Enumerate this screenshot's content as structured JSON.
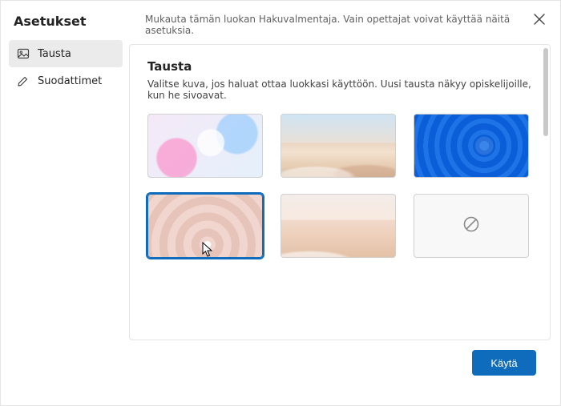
{
  "dialog": {
    "title": "Asetukset",
    "intro": "Mukauta tämän luokan Hakuvalmentaja. Vain opettajat voivat käyttää näitä asetuksia."
  },
  "sidebar": {
    "items": [
      {
        "id": "tausta",
        "label": "Tausta",
        "icon": "image-icon",
        "active": true
      },
      {
        "id": "suodattimet",
        "label": "Suodattimet",
        "icon": "pencil-icon",
        "active": false
      }
    ]
  },
  "panel": {
    "heading": "Tausta",
    "description": "Valitse kuva, jos haluat ottaa luokkasi käyttöön. Uusi tausta näkyy opiskelijoille, kun he sivoavat.",
    "backgrounds": [
      {
        "id": "abstract-bubbles",
        "selected": false,
        "kind": "image"
      },
      {
        "id": "desert-dunes",
        "selected": false,
        "kind": "image"
      },
      {
        "id": "windows-bloom",
        "selected": false,
        "kind": "image"
      },
      {
        "id": "pink-petals",
        "selected": true,
        "kind": "image"
      },
      {
        "id": "sand-pastel",
        "selected": false,
        "kind": "image"
      },
      {
        "id": "none",
        "selected": false,
        "kind": "none"
      }
    ]
  },
  "footer": {
    "apply_label": "Käytä"
  },
  "icons": {
    "close": "close-icon",
    "none_glyph": "⊘"
  }
}
